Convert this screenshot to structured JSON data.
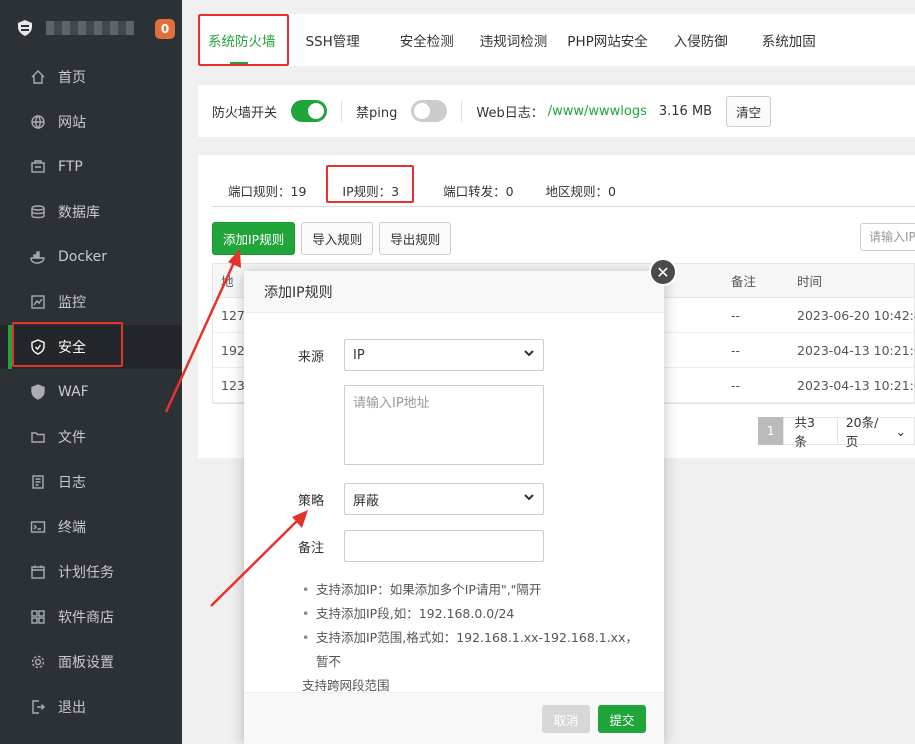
{
  "sidebar": {
    "badge": "0",
    "items": [
      {
        "label": "首页",
        "icon": "home-icon"
      },
      {
        "label": "网站",
        "icon": "globe-icon"
      },
      {
        "label": "FTP",
        "icon": "ftp-icon"
      },
      {
        "label": "数据库",
        "icon": "database-icon"
      },
      {
        "label": "Docker",
        "icon": "docker-icon"
      },
      {
        "label": "监控",
        "icon": "monitor-icon"
      },
      {
        "label": "安全",
        "icon": "shield-icon"
      },
      {
        "label": "WAF",
        "icon": "waf-shield-icon"
      },
      {
        "label": "文件",
        "icon": "folder-icon"
      },
      {
        "label": "日志",
        "icon": "log-icon"
      },
      {
        "label": "终端",
        "icon": "terminal-icon"
      },
      {
        "label": "计划任务",
        "icon": "calendar-icon"
      },
      {
        "label": "软件商店",
        "icon": "apps-icon"
      },
      {
        "label": "面板设置",
        "icon": "gear-icon"
      },
      {
        "label": "退出",
        "icon": "logout-icon"
      }
    ],
    "active_index": 6
  },
  "tabs": [
    "系统防火墙",
    "SSH管理",
    "安全检测",
    "违规词检测",
    "PHP网站安全",
    "入侵防御",
    "系统加固"
  ],
  "firewall_bar": {
    "switch_label": "防火墙开关",
    "ping_label": "禁ping",
    "weblog_label": "Web日志：",
    "weblog_path": "/www/wwwlogs",
    "weblog_size": "3.16 MB",
    "clear_label": "清空"
  },
  "subtabs": [
    "端口规则：19",
    "IP规则：3",
    "端口转发：0",
    "地区规则：0"
  ],
  "actions": {
    "add": "添加IP规则",
    "import": "导入规则",
    "export": "导出规则",
    "search_placeholder": "请输入IP"
  },
  "table": {
    "headers": {
      "col1": "地",
      "remark": "备注",
      "time": "时间"
    },
    "rows": [
      {
        "ip": "127.",
        "remark": "--",
        "time": "2023-06-20 10:42:41"
      },
      {
        "ip": "192.",
        "remark": "--",
        "time": "2023-04-13 10:21:03"
      },
      {
        "ip": "123.",
        "remark": "--",
        "time": "2023-04-13 10:21:03"
      }
    ]
  },
  "pager": {
    "page": "1",
    "total": "共3条",
    "size": "20条/页"
  },
  "modal": {
    "title": "添加IP规则",
    "source_label": "来源",
    "source_value": "IP",
    "ip_placeholder": "请输入IP地址",
    "strategy_label": "策略",
    "strategy_value": "屏蔽",
    "remark_label": "备注",
    "notes": [
      "支持添加IP：如果添加多个IP请用\",\"隔开",
      "支持添加IP段,如：192.168.0.0/24",
      "支持添加IP范围,格式如：192.168.1.xx-192.168.1.xx，暂不"
    ],
    "note_wrap": "支持跨网段范围",
    "cancel": "取消",
    "submit": "提交"
  },
  "colors": {
    "accent": "#20a53a",
    "sidebar": "#2c3136",
    "highlight": "#e5322d",
    "badge": "#e0703a"
  }
}
